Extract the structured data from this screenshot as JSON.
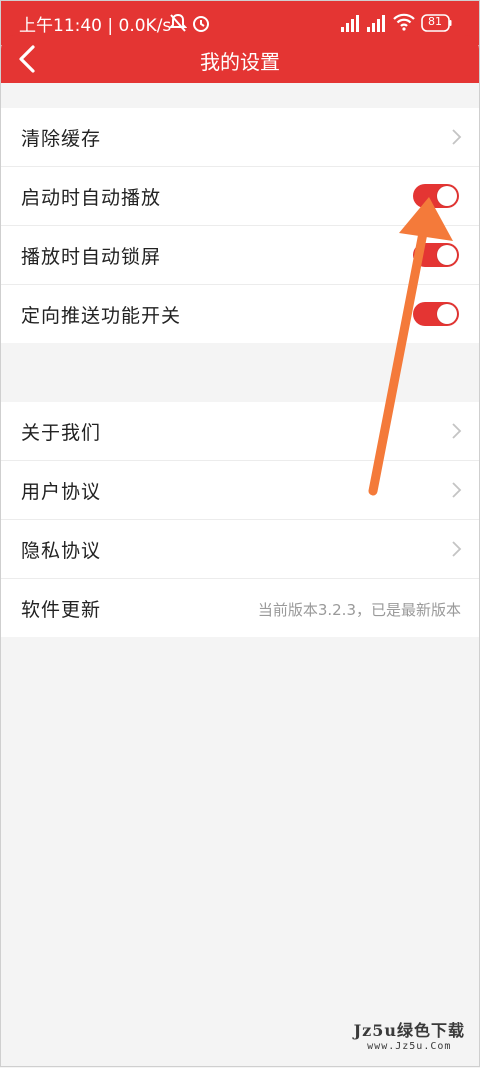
{
  "status_bar": {
    "left_text": "上午11:40 | 0.0K/s",
    "battery": "81"
  },
  "header": {
    "title": "我的设置"
  },
  "group1": {
    "items": [
      {
        "label": "清除缓存",
        "type": "chevron"
      },
      {
        "label": "启动时自动播放",
        "type": "toggle",
        "on": true
      },
      {
        "label": "播放时自动锁屏",
        "type": "toggle",
        "on": true
      },
      {
        "label": "定向推送功能开关",
        "type": "toggle",
        "on": true
      }
    ]
  },
  "group2": {
    "items": [
      {
        "label": "关于我们",
        "type": "chevron"
      },
      {
        "label": "用户协议",
        "type": "chevron"
      },
      {
        "label": "隐私协议",
        "type": "chevron"
      },
      {
        "label": "软件更新",
        "type": "value",
        "value": "当前版本3.2.3，已是最新版本"
      }
    ]
  },
  "watermark": {
    "line1": "Jz5u绿色下载",
    "line2": "www.Jz5u.Com"
  },
  "colors": {
    "accent": "#e43533",
    "annotation_arrow": "#f47a3a",
    "background": "#f4f4f4"
  }
}
